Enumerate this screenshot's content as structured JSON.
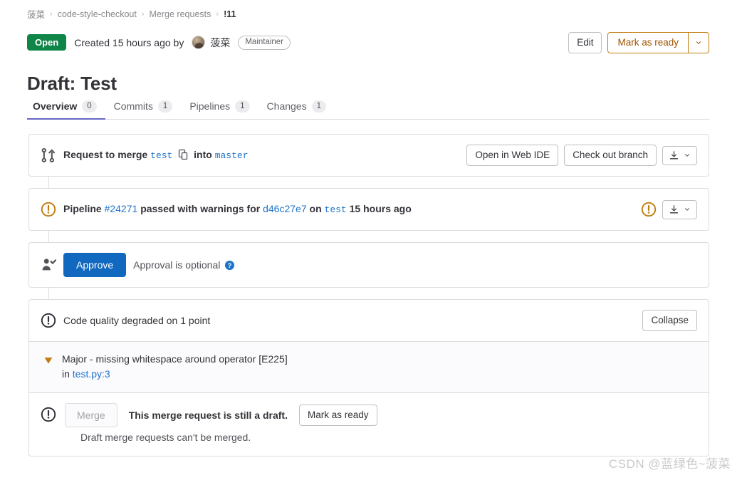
{
  "breadcrumb": {
    "items": [
      {
        "label": "菠菜",
        "current": false
      },
      {
        "label": "code-style-checkout",
        "current": false
      },
      {
        "label": "Merge requests",
        "current": false
      },
      {
        "label": "!11",
        "current": true
      }
    ],
    "separator": "›"
  },
  "status": {
    "badge": "Open",
    "badge_color": "#108548",
    "created_text": "Created 15 hours ago by",
    "author": "菠菜",
    "role": "Maintainer"
  },
  "header_actions": {
    "edit_label": "Edit",
    "mark_ready_label": "Mark as ready",
    "mark_ready_color": "#9e5400",
    "caret_icon": "chevron-down-icon"
  },
  "title": "Draft: Test",
  "tabs": [
    {
      "label": "Overview",
      "count": "0",
      "active": true
    },
    {
      "label": "Commits",
      "count": "1",
      "active": false
    },
    {
      "label": "Pipelines",
      "count": "1",
      "active": false
    },
    {
      "label": "Changes",
      "count": "1",
      "active": false
    }
  ],
  "tab_accent_color": "#6666c4",
  "widgets": {
    "source_branch": {
      "icon": "merge-request-icon",
      "prefix": "Request to merge",
      "source": "test",
      "copy_icon": "copy-icon",
      "middle": "into",
      "target": "master",
      "buttons": {
        "web_ide": "Open in Web IDE",
        "check_out": "Check out branch",
        "download_icon": "download-icon",
        "caret_icon": "chevron-down-icon"
      }
    },
    "pipeline": {
      "icon": "warning-circle-icon",
      "icon_color": "#c17d10",
      "prefix": "Pipeline",
      "pipeline_id": "#24271",
      "status_text": "passed with warnings for",
      "commit_sha": "d46c27e7",
      "on_text": "on",
      "branch": "test",
      "time": "15 hours ago",
      "status_icon": "warning-circle-icon",
      "download_icon": "download-icon",
      "caret_icon": "chevron-down-icon"
    },
    "approval": {
      "icon": "user-check-icon",
      "approve_label": "Approve",
      "approve_color": "#1068bf",
      "note": "Approval is optional",
      "help_icon": "question-circle-icon"
    },
    "code_quality": {
      "icon": "exclamation-circle-icon",
      "summary": "Code quality degraded on 1 point",
      "collapse_label": "Collapse",
      "finding": {
        "severity_icon": "severity-major-icon",
        "severity_color": "#c17d10",
        "description": "Major - missing whitespace around operator [E225]",
        "in_label": "in",
        "file": "test.py:3"
      }
    },
    "merge": {
      "icon": "exclamation-circle-icon",
      "merge_label": "Merge",
      "draft_message": "This merge request is still a draft.",
      "mark_ready_label": "Mark as ready",
      "sub_message": "Draft merge requests can't be merged."
    }
  },
  "watermark": "CSDN @蓝绿色~菠菜"
}
